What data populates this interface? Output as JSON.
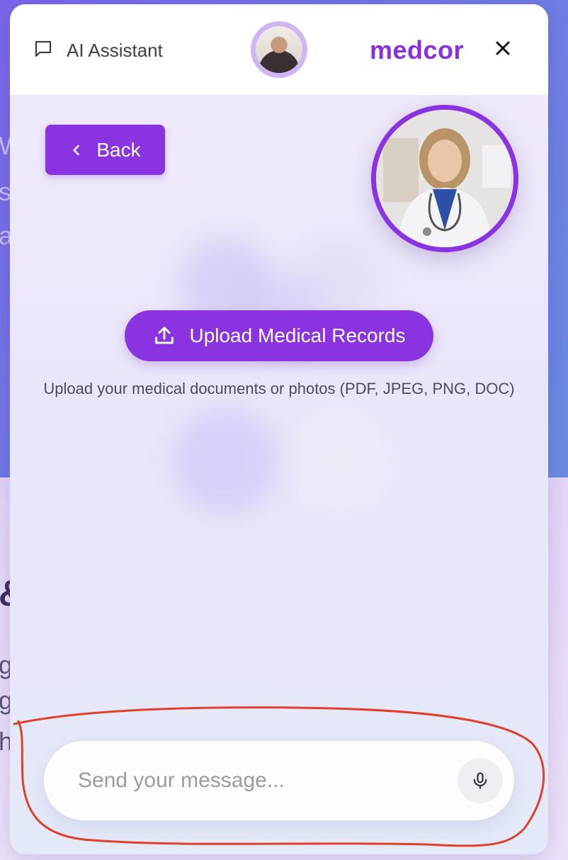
{
  "background": {
    "fragments_light": [
      "W",
      "s",
      "a"
    ],
    "fragment_bold": "&",
    "fragments_dark": [
      "g",
      "g",
      "h"
    ]
  },
  "header": {
    "title": "AI Assistant",
    "brand": "medcor",
    "icons": {
      "chat": "chat-bubble-icon",
      "close": "close-icon"
    }
  },
  "main": {
    "back_label": "Back",
    "upload_label": "Upload Medical Records",
    "upload_hint": "Upload your medical documents or photos (PDF, JPEG, PNG, DOC)"
  },
  "composer": {
    "placeholder": "Send your message...",
    "mic_icon": "microphone-icon"
  },
  "colors": {
    "accent": "#8a33e0",
    "brand": "#8a2fe0",
    "annotation": "#e0402a"
  }
}
